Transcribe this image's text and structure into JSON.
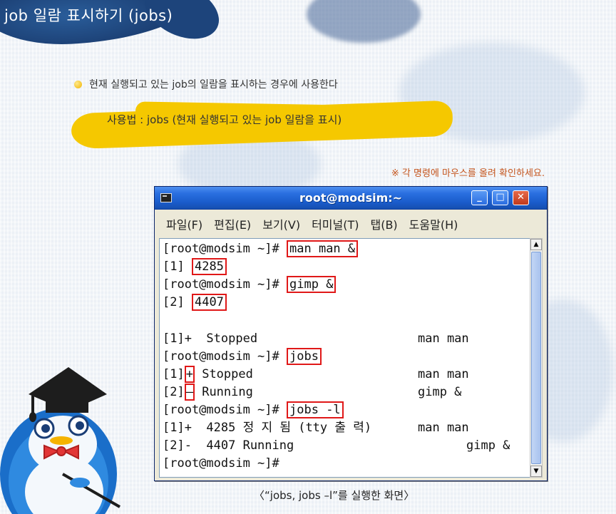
{
  "page": {
    "title": "job 일람 표시하기 (jobs)",
    "description": "현재 실행되고 있는 job의 일람을 표시하는 경우에 사용한다",
    "usage": "사용법 : jobs (현재 실행되고 있는 job 일람을 표시)",
    "hint": "※ 각 명령에 마우스를 올려 확인하세요.",
    "caption": "〈“jobs, jobs –l”를 실행한 화면〉"
  },
  "terminal": {
    "title": "root@modsim:~",
    "window_buttons": {
      "minimize": "_",
      "maximize": "□",
      "close": "✕"
    },
    "menu": [
      "파일(F)",
      "편집(E)",
      "보기(V)",
      "터미널(T)",
      "탭(B)",
      "도움말(H)"
    ],
    "prompt": "[root@modsim ~]#",
    "lines": {
      "l1_cmd": "man man &",
      "l2_prefix": "[1]",
      "l2_pid": "4285",
      "l3_cmd": "gimp &",
      "l4_prefix": "[2]",
      "l4_pid": "4407",
      "l6_left": "[1]+  Stopped",
      "l6_right": "man man",
      "l7_cmd": "jobs",
      "l8_prefix": "[1]",
      "l8_mark": "+",
      "l8_status": " Stopped",
      "l8_right": "man man",
      "l9_prefix": "[2]",
      "l9_mark": "–",
      "l9_status": " Running",
      "l9_right": "gimp &",
      "l10_cmd": "jobs -l",
      "l11_left": "[1]+  4285 정 지 됨 (tty 출 력)",
      "l11_right": "man man",
      "l12_left": "[2]-  4407 Running",
      "l12_right": "gimp &"
    }
  },
  "icons": [
    "terminal-app-icon",
    "minimize-icon",
    "maximize-icon",
    "close-icon",
    "scroll-up-icon",
    "scroll-down-icon",
    "bullet-icon",
    "penguin-mascot"
  ],
  "colors": {
    "title_banner": "#1b3e72",
    "usage_highlight": "#f5c800",
    "hint_text": "#c4541c",
    "command_highlight": "#e01818",
    "titlebar": "#2a6fe0"
  }
}
